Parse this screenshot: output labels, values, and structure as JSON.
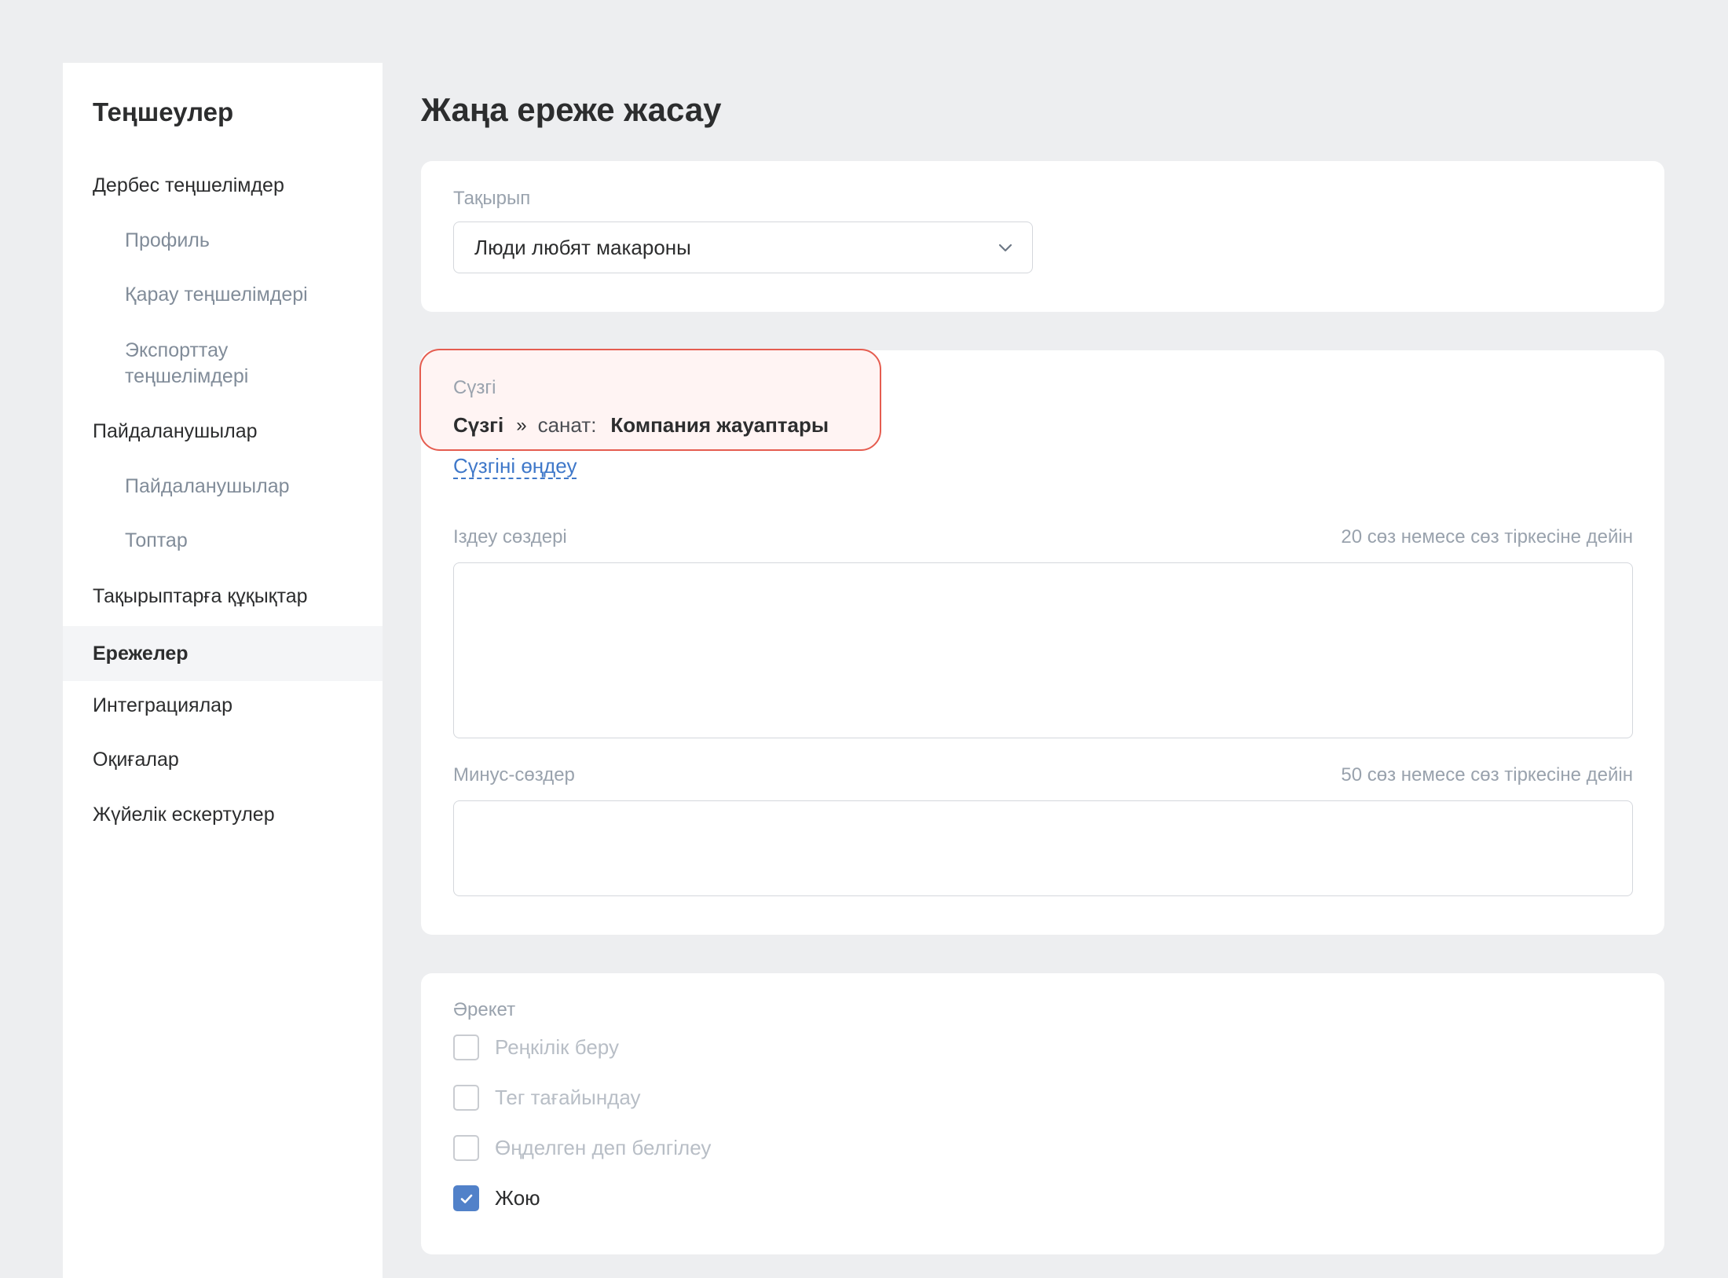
{
  "sidebar": {
    "title": "Теңшеулер",
    "items": [
      {
        "label": "Дербес теңшелімдер"
      },
      {
        "label": "Профиль"
      },
      {
        "label": "Қарау теңшелімдері"
      },
      {
        "label": "Экспорттау теңшелімдері"
      },
      {
        "label": "Пайдаланушылар"
      },
      {
        "label": "Пайдаланушылар"
      },
      {
        "label": "Топтар"
      },
      {
        "label": "Тақырыптарға құқықтар"
      },
      {
        "label": "Ережелер"
      },
      {
        "label": "Интеграциялар"
      },
      {
        "label": "Оқиғалар"
      },
      {
        "label": "Жүйелік ескертулер"
      }
    ]
  },
  "page": {
    "title": "Жаңа ереже жасау"
  },
  "topic": {
    "label": "Тақырып",
    "value": "Люди любят макароны"
  },
  "filter": {
    "label": "Сүзгі",
    "name": "Сүзгі",
    "separator": "»",
    "category_label": "санат:",
    "category_value": "Компания жауаптары",
    "edit_link": "Сүзгіні өңдеу"
  },
  "search_words": {
    "label": "Іздеу сөздері",
    "hint": "20 сөз немесе сөз тіркесіне дейін",
    "value": ""
  },
  "minus_words": {
    "label": "Минус-сөздер",
    "hint": "50 сөз немесе сөз тіркесіне дейін",
    "value": ""
  },
  "action": {
    "label": "Әрекет",
    "options": [
      {
        "label": "Реңкілік беру",
        "checked": false,
        "disabled": true
      },
      {
        "label": "Тег тағайындау",
        "checked": false,
        "disabled": true
      },
      {
        "label": "Өңделген деп белгілеу",
        "checked": false,
        "disabled": true
      },
      {
        "label": "Жою",
        "checked": true,
        "disabled": false
      }
    ]
  },
  "colors": {
    "accent": "#5181c9",
    "link": "#3f78c9",
    "highlight_border": "#e55c4f"
  }
}
